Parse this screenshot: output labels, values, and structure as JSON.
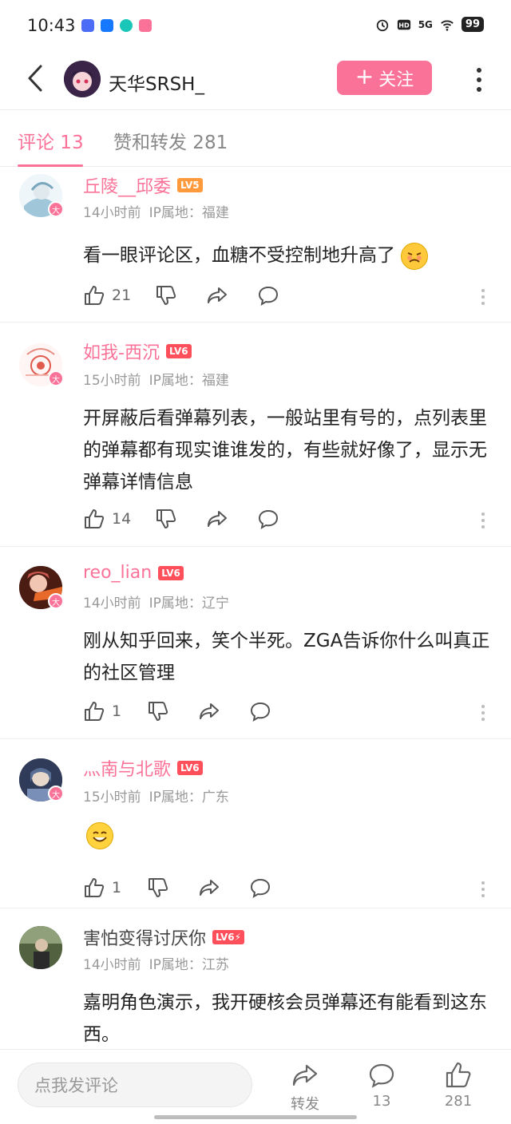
{
  "status_bar": {
    "time": "10:43",
    "network": "5G",
    "battery": "99",
    "app_icon_colors": [
      "#4a6cf7",
      "#1677ff",
      "#19c6b8",
      "#fb7299"
    ]
  },
  "header": {
    "author_name": "天华SRSH_",
    "follow_label": "关注"
  },
  "tabs": [
    {
      "label": "评论 13",
      "active": true
    },
    {
      "label": "赞和转发 281",
      "active": false
    }
  ],
  "comments": [
    {
      "username": "丘陵__邱委",
      "level": "LV5",
      "level_color": "#ff9a3c",
      "name_style": "vip",
      "time": "14小时前",
      "ip": "IP属地：福建",
      "text": "看一眼评论区，血糖不受控制地升高了",
      "emoji": "angry-face",
      "likes": "21",
      "badge": "大"
    },
    {
      "username": "如我-西沉",
      "level": "LV6",
      "level_color": "#ff4f5a",
      "name_style": "vip",
      "time": "15小时前",
      "ip": "IP属地：福建",
      "text": "开屏蔽后看弹幕列表，一般站里有号的，点列表里的弹幕都有现实谁谁发的，有些就好像了，显示无弹幕详情信息",
      "likes": "14",
      "badge": "大"
    },
    {
      "username": "reo_lian",
      "level": "LV6",
      "level_color": "#ff4f5a",
      "name_style": "vip",
      "time": "14小时前",
      "ip": "IP属地：辽宁",
      "text": "刚从知乎回来，笑个半死。ZGA告诉你什么叫真正的社区管理",
      "likes": "1",
      "badge": "大"
    },
    {
      "username": "灬南与北歌",
      "level": "LV6",
      "level_color": "#ff4f5a",
      "name_style": "vip",
      "time": "15小时前",
      "ip": "IP属地：广东",
      "text": "",
      "emoji": "smiling-face",
      "likes": "1",
      "badge": "大"
    },
    {
      "username": "害怕变得讨厌你",
      "level": "LV6⚡",
      "level_color": "#ff4f5a",
      "name_style": "plain",
      "time": "14小时前",
      "ip": "IP属地：江苏",
      "text": "嘉明角色演示，我开硬核会员弹幕还有能看到这东西。",
      "likes": ""
    }
  ],
  "bottom_bar": {
    "input_placeholder": "点我发评论",
    "share_label": "转发",
    "comment_count": "13",
    "like_count": "281"
  },
  "colors": {
    "accent": "#fb7299"
  }
}
